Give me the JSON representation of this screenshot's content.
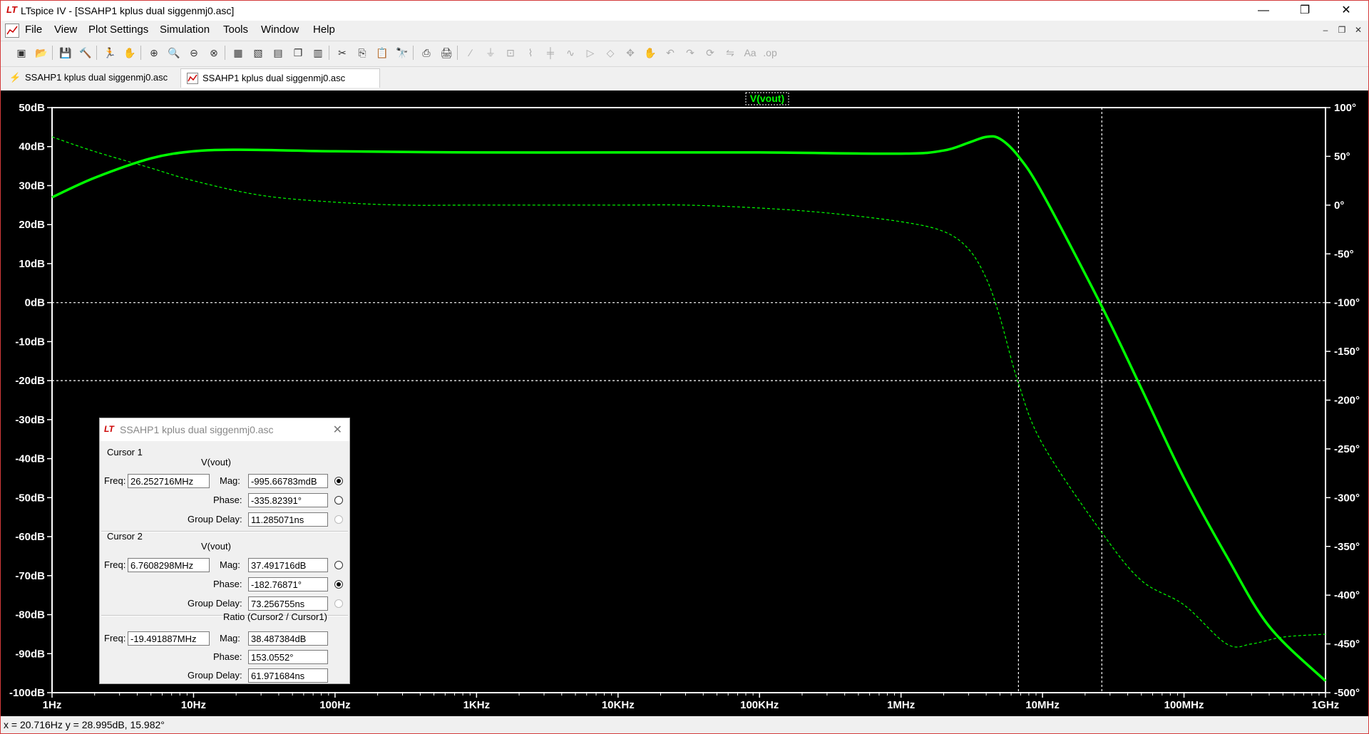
{
  "window": {
    "title": "LTspice IV - [SSAHP1 kplus dual siggenmj0.asc]",
    "logo_text": "LT",
    "minimize": "—",
    "restore": "❐",
    "close": "✕"
  },
  "menu": {
    "items": [
      "File",
      "View",
      "Plot Settings",
      "Simulation",
      "Tools",
      "Window",
      "Help"
    ],
    "mdi_minimize": "–",
    "mdi_restore": "❐",
    "mdi_close": "✕"
  },
  "tabs": [
    {
      "label": "SSAHP1 kplus dual siggenmj0.asc",
      "icon": "schematic-icon",
      "active": false
    },
    {
      "label": "SSAHP1 kplus dual siggenmj0.asc",
      "icon": "waveform-icon",
      "active": true
    }
  ],
  "toolbar": {
    "icons": [
      "new-schematic-icon",
      "open-icon",
      "save-icon",
      "control-panel-icon",
      "run-icon",
      "halt-icon",
      "zoom-in-icon",
      "zoom-extents-icon",
      "zoom-out-icon",
      "cancel-zoom-icon",
      "autoscale-icon",
      "multiple-axes-icon",
      "tile-horizontal-icon",
      "cascade-icon",
      "tile-vertical-icon",
      "cut-icon",
      "copy-icon",
      "paste-icon",
      "find-icon",
      "print-preview-icon",
      "print-icon",
      "wire-icon",
      "ground-icon",
      "label-icon",
      "resistor-icon",
      "capacitor-icon",
      "inductor-icon",
      "diode-icon",
      "component-icon",
      "move-icon",
      "drag-icon",
      "undo-icon",
      "redo-icon",
      "rotate-icon",
      "mirror-icon",
      "text-icon",
      "spice-directive-icon"
    ]
  },
  "plot": {
    "trace_label": "V(vout)",
    "background": "#000000",
    "trace_color": "#00ff00",
    "grid_color": "#ffffff"
  },
  "chart_data": {
    "type": "line",
    "title": "V(vout)",
    "xscale": "log",
    "xlim": [
      1,
      1000000000
    ],
    "x_ticks": [
      "1Hz",
      "10Hz",
      "100Hz",
      "1KHz",
      "10KHz",
      "100KHz",
      "1MHz",
      "10MHz",
      "100MHz",
      "1GHz"
    ],
    "y_left_ticks": [
      "50dB",
      "40dB",
      "30dB",
      "20dB",
      "10dB",
      "0dB",
      "-10dB",
      "-20dB",
      "-30dB",
      "-40dB",
      "-50dB",
      "-60dB",
      "-70dB",
      "-80dB",
      "-90dB",
      "-100dB"
    ],
    "y_left_lim": [
      -100,
      50
    ],
    "y_right_ticks": [
      "100°",
      "50°",
      "0°",
      "-50°",
      "-100°",
      "-150°",
      "-200°",
      "-250°",
      "-300°",
      "-350°",
      "-400°",
      "-450°",
      "-500°"
    ],
    "y_right_lim": [
      -500,
      100
    ],
    "cursors_x": [
      6760829.8,
      26252716
    ],
    "cursors_y_db": [
      0,
      -20
    ],
    "series": [
      {
        "name": "Magnitude",
        "style": "solid",
        "unit": "dB",
        "x": [
          1,
          2,
          5,
          10,
          20,
          50,
          100,
          1000,
          10000,
          100000,
          1000000,
          2000000,
          3000000,
          4000000,
          5000000,
          6760829.8,
          10000000,
          26252716,
          50000000,
          100000000,
          200000000,
          400000000,
          1000000000
        ],
        "y": [
          27,
          32,
          37,
          38.8,
          39.2,
          39.0,
          38.8,
          38.5,
          38.5,
          38.5,
          38.2,
          39.0,
          41.0,
          42.5,
          42.0,
          37.5,
          28.0,
          -1.0,
          -22.0,
          -45.0,
          -65.0,
          -83.0,
          -97.0
        ]
      },
      {
        "name": "Phase",
        "style": "dashed",
        "unit": "deg",
        "x": [
          1,
          2,
          5,
          10,
          30,
          100,
          300,
          1000,
          10000,
          30000,
          100000,
          300000,
          1000000,
          2000000,
          3000000,
          4000000,
          5000000,
          6760829.8,
          10000000,
          26252716,
          50000000,
          100000000,
          200000000,
          300000000,
          500000000,
          1000000000
        ],
        "y": [
          70,
          55,
          38,
          25,
          10,
          3,
          0,
          0,
          0,
          0,
          -3,
          -8,
          -17,
          -27,
          -45,
          -75,
          -115,
          -182.8,
          -245,
          -335.8,
          -385,
          -410,
          -450,
          -450,
          -443,
          -440
        ]
      }
    ]
  },
  "cursor_dialog": {
    "title": "SSAHP1 kplus dual siggenmj0.asc",
    "logo_text": "LT",
    "close": "✕",
    "cursor1": {
      "header": "Cursor 1",
      "trace": "V(vout)",
      "freq_label": "Freq:",
      "freq": "26.252716MHz",
      "mag_label": "Mag:",
      "mag": "-995.66783mdB",
      "phase_label": "Phase:",
      "phase": "-335.82391°",
      "gd_label": "Group Delay:",
      "gd": "11.285071ns"
    },
    "cursor2": {
      "header": "Cursor 2",
      "trace": "V(vout)",
      "freq_label": "Freq:",
      "freq": "6.7608298MHz",
      "mag_label": "Mag:",
      "mag": "37.491716dB",
      "phase_label": "Phase:",
      "phase": "-182.76871°",
      "gd_label": "Group Delay:",
      "gd": "73.256755ns"
    },
    "ratio": {
      "header": "Ratio (Cursor2 / Cursor1)",
      "freq_label": "Freq:",
      "freq": "-19.491887MHz",
      "mag_label": "Mag:",
      "mag": "38.487384dB",
      "phase_label": "Phase:",
      "phase": "153.0552°",
      "gd_label": "Group Delay:",
      "gd": "61.971684ns"
    }
  },
  "status": {
    "text": "x = 20.716Hz    y = 28.995dB, 15.982°"
  }
}
